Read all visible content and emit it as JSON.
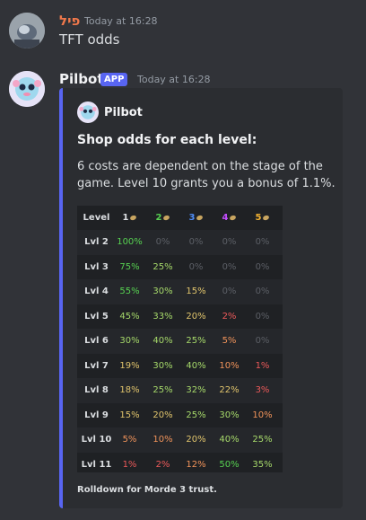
{
  "messages": [
    {
      "username": "פיל",
      "username_color": "#f0784b",
      "timestamp": "Today at 16:28",
      "text": "TFT odds"
    },
    {
      "username": "Pilbot",
      "username_color": "#f2f3f5",
      "badge": "APP",
      "timestamp": "Today at 16:28"
    }
  ],
  "embed": {
    "author": "Pilbot",
    "title": "Shop odds for each level:",
    "description": "6 costs are dependent on the stage of the game. Level 10 grants you a bonus of 1.1%.",
    "footer": "Rolldown for Morde 3 trust.",
    "accent_color": "#5865f2",
    "table": {
      "header": [
        "Level",
        "1",
        "2",
        "3",
        "4",
        "5"
      ],
      "header_colors": [
        "#dbdee1",
        "#dbdee1",
        "#57d151",
        "#4f8df7",
        "#c44dff",
        "#f0b132"
      ],
      "rows": [
        {
          "level": "Lvl 2",
          "values": [
            "100%",
            "0%",
            "0%",
            "0%",
            "0%"
          ]
        },
        {
          "level": "Lvl 3",
          "values": [
            "75%",
            "25%",
            "0%",
            "0%",
            "0%"
          ]
        },
        {
          "level": "Lvl 4",
          "values": [
            "55%",
            "30%",
            "15%",
            "0%",
            "0%"
          ]
        },
        {
          "level": "Lvl 5",
          "values": [
            "45%",
            "33%",
            "20%",
            "2%",
            "0%"
          ]
        },
        {
          "level": "Lvl 6",
          "values": [
            "30%",
            "40%",
            "25%",
            "5%",
            "0%"
          ]
        },
        {
          "level": "Lvl 7",
          "values": [
            "19%",
            "30%",
            "40%",
            "10%",
            "1%"
          ]
        },
        {
          "level": "Lvl 8",
          "values": [
            "18%",
            "25%",
            "32%",
            "22%",
            "3%"
          ]
        },
        {
          "level": "Lvl 9",
          "values": [
            "15%",
            "20%",
            "25%",
            "30%",
            "10%"
          ]
        },
        {
          "level": "Lvl 10",
          "values": [
            "5%",
            "10%",
            "20%",
            "40%",
            "25%"
          ]
        },
        {
          "level": "Lvl 11",
          "values": [
            "1%",
            "2%",
            "12%",
            "50%",
            "35%"
          ]
        }
      ]
    }
  }
}
